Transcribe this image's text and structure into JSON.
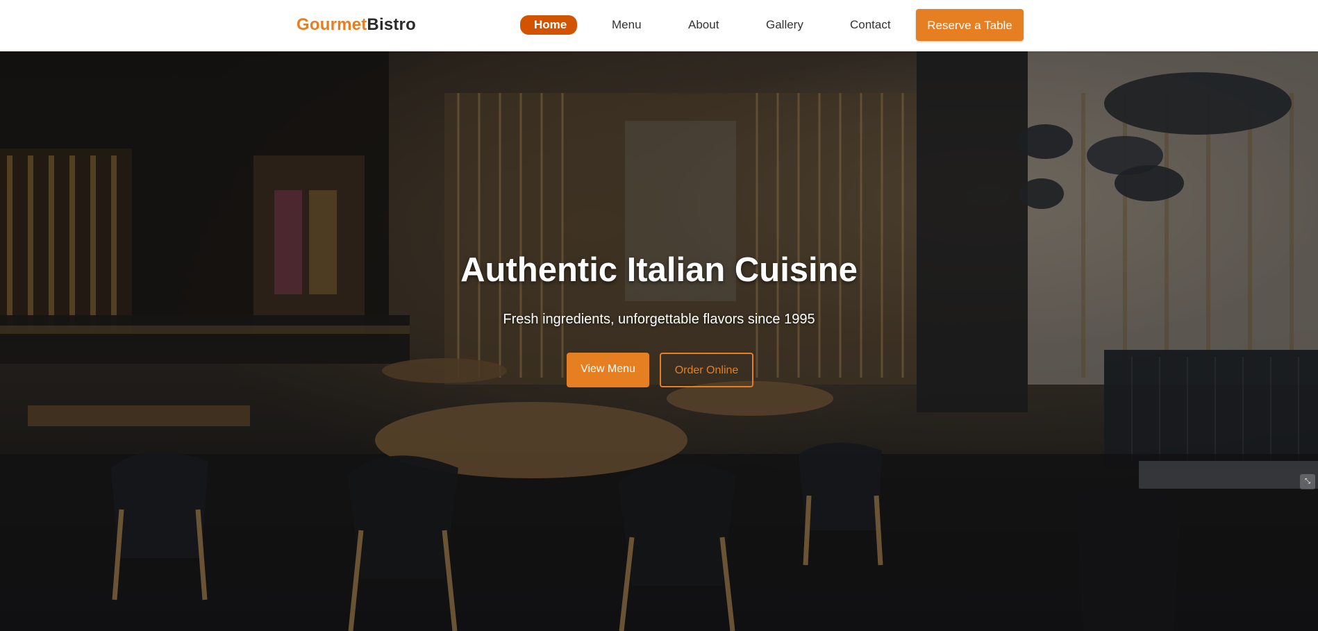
{
  "brand": {
    "logo_part1": "Gourmet",
    "logo_part2": "Bistro",
    "accent_color": "#e67e22",
    "active_nav_color": "#d35400"
  },
  "nav": {
    "items": [
      {
        "label": "Home",
        "active": true
      },
      {
        "label": "Menu",
        "active": false
      },
      {
        "label": "About",
        "active": false
      },
      {
        "label": "Gallery",
        "active": false
      },
      {
        "label": "Contact",
        "active": false
      }
    ],
    "cta_label": "Reserve a Table"
  },
  "hero": {
    "title": "Authentic Italian Cuisine",
    "subtitle": "Fresh ingredients, unforgettable flavors since 1995",
    "primary_button": "View Menu",
    "secondary_button": "Order Online",
    "background_image": "restaurant-interior-photo"
  },
  "icons": {
    "corner_icon": "expand-icon"
  }
}
